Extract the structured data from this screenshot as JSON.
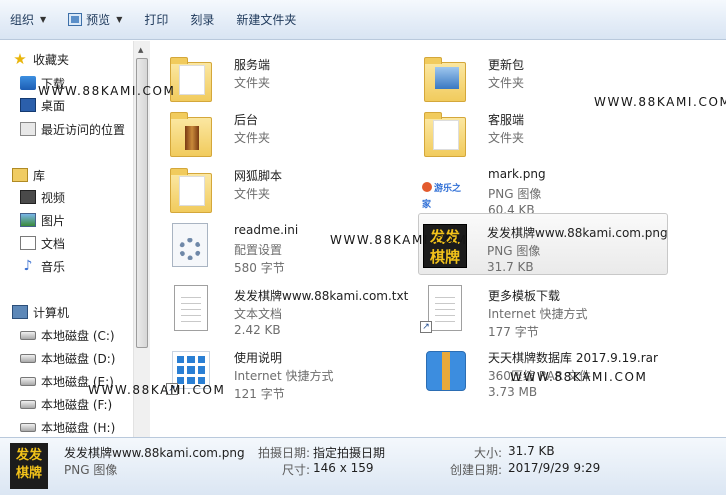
{
  "toolbar": {
    "organize": "组织",
    "preview": "预览",
    "print": "打印",
    "burn": "刻录",
    "new_folder": "新建文件夹"
  },
  "nav": {
    "favorites": "收藏夹",
    "downloads": "下载",
    "desktop": "桌面",
    "recent": "最近访问的位置",
    "libraries": "库",
    "videos": "视频",
    "pictures": "图片",
    "documents": "文档",
    "music": "音乐",
    "computer": "计算机",
    "disk_c": "本地磁盘 (C:)",
    "disk_d": "本地磁盘 (D:)",
    "disk_e": "本地磁盘 (E:)",
    "disk_f": "本地磁盘 (F:)",
    "disk_h": "本地磁盘 (H:)"
  },
  "files": [
    {
      "name": "服务端",
      "type": "文件夹",
      "size": ""
    },
    {
      "name": "更新包",
      "type": "文件夹",
      "size": ""
    },
    {
      "name": "后台",
      "type": "文件夹",
      "size": ""
    },
    {
      "name": "客服端",
      "type": "文件夹",
      "size": ""
    },
    {
      "name": "网狐脚本",
      "type": "文件夹",
      "size": ""
    },
    {
      "name": "mark.png",
      "type": "PNG 图像",
      "size": "60.4 KB"
    },
    {
      "name": "readme.ini",
      "type": "配置设置",
      "size": "580 字节"
    },
    {
      "name": "发发棋牌www.88kami.com.png",
      "type": "PNG 图像",
      "size": "31.7 KB"
    },
    {
      "name": "发发棋牌www.88kami.com.txt",
      "type": "文本文档",
      "size": "2.42 KB"
    },
    {
      "name": "更多模板下载",
      "type": "Internet 快捷方式",
      "size": "177 字节"
    },
    {
      "name": "使用说明",
      "type": "Internet 快捷方式",
      "size": "121 字节"
    },
    {
      "name": "天天棋牌数据库 2017.9.19.rar",
      "type": "360压缩 RAR 文件",
      "size": "3.73 MB"
    }
  ],
  "icons": {
    "mark_logo": "游乐之家",
    "game_logo_top": "发发",
    "game_logo_bottom": "棋牌"
  },
  "watermark": "WWW.88KAMI.COM",
  "details": {
    "name": "发发棋牌www.88kami.com.png",
    "type": "PNG 图像",
    "shot_date_label": "拍摄日期:",
    "shot_date_value": "指定拍摄日期",
    "dimensions_label": "尺寸:",
    "dimensions_value": "146 x 159",
    "size_label": "大小:",
    "size_value": "31.7 KB",
    "created_label": "创建日期:",
    "created_value": "2017/9/29 9:29"
  }
}
